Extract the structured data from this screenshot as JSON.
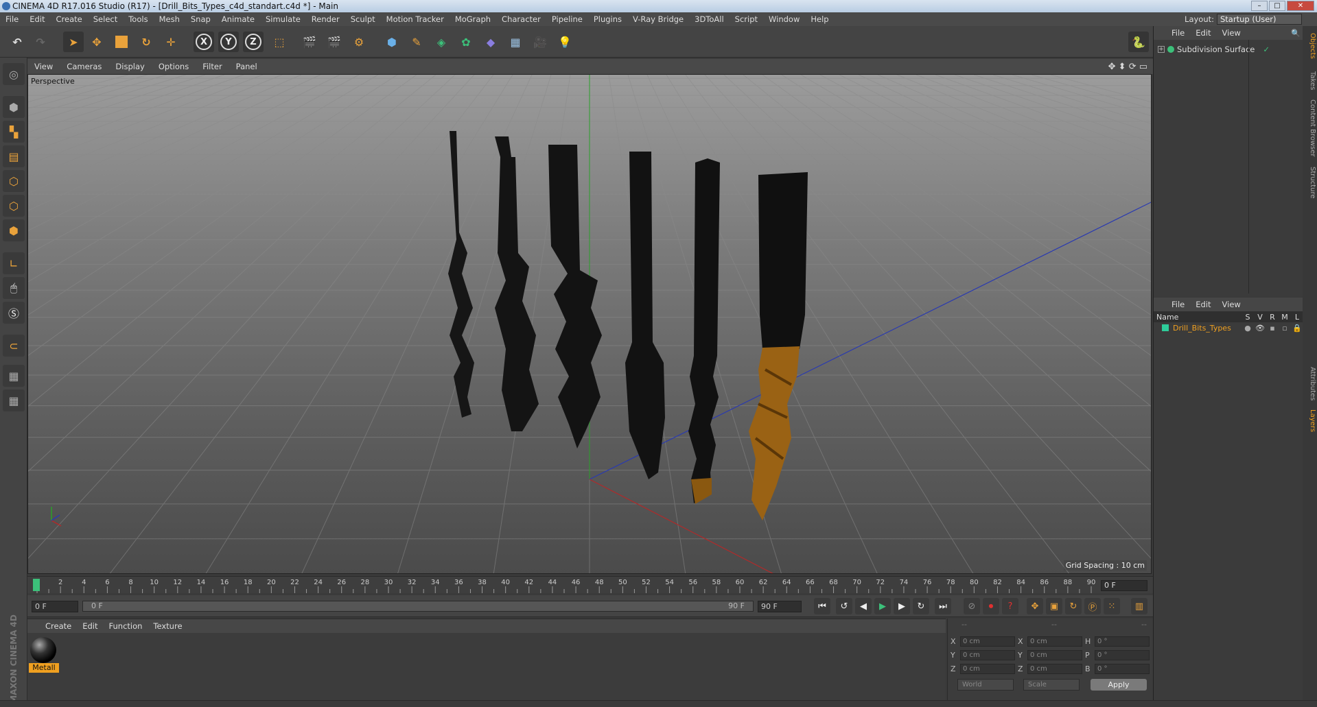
{
  "window": {
    "title": "CINEMA 4D R17.016 Studio (R17) - [Drill_Bits_Types_c4d_standart.c4d *] - Main"
  },
  "menubar": {
    "items": [
      "File",
      "Edit",
      "Create",
      "Select",
      "Tools",
      "Mesh",
      "Snap",
      "Animate",
      "Simulate",
      "Render",
      "Sculpt",
      "Motion Tracker",
      "MoGraph",
      "Character",
      "Pipeline",
      "Plugins",
      "V-Ray Bridge",
      "3DToAll",
      "Script",
      "Window",
      "Help"
    ],
    "layout_label": "Layout:",
    "layout_value": "Startup (User)"
  },
  "toolbar": {
    "axis_x": "X",
    "axis_y": "Y",
    "axis_z": "Z"
  },
  "viewport": {
    "menu": [
      "View",
      "Cameras",
      "Display",
      "Options",
      "Filter",
      "Panel"
    ],
    "label": "Perspective",
    "grid_spacing": "Grid Spacing : 10 cm"
  },
  "timeline": {
    "ticks": [
      "0",
      "2",
      "4",
      "6",
      "8",
      "10",
      "12",
      "14",
      "16",
      "18",
      "20",
      "22",
      "24",
      "26",
      "28",
      "30",
      "32",
      "34",
      "36",
      "38",
      "40",
      "42",
      "44",
      "46",
      "48",
      "50",
      "52",
      "54",
      "56",
      "58",
      "60",
      "62",
      "64",
      "66",
      "68",
      "70",
      "72",
      "74",
      "76",
      "78",
      "80",
      "82",
      "84",
      "86",
      "88",
      "90"
    ],
    "current_frame": "0 F"
  },
  "playbar": {
    "start_field": "0 F",
    "scrub_start": "0 F",
    "scrub_end": "90 F",
    "end_field": "90 F"
  },
  "material_manager": {
    "menu": [
      "Create",
      "Edit",
      "Function",
      "Texture"
    ],
    "materials": [
      {
        "name": "Metall"
      }
    ]
  },
  "brand": {
    "logo_text": "MAXON CINEMA 4D"
  },
  "coordinates": {
    "header": [
      "--",
      "--",
      "--"
    ],
    "rows": [
      {
        "a": "X",
        "av": "0 cm",
        "b": "X",
        "bv": "0 cm",
        "c": "H",
        "cv": "0 °"
      },
      {
        "a": "Y",
        "av": "0 cm",
        "b": "Y",
        "bv": "0 cm",
        "c": "P",
        "cv": "0 °"
      },
      {
        "a": "Z",
        "av": "0 cm",
        "b": "Z",
        "bv": "0 cm",
        "c": "B",
        "cv": "0 °"
      }
    ],
    "mode_world": "World",
    "mode_scale": "Scale",
    "apply": "Apply"
  },
  "object_manager": {
    "menu": [
      "File",
      "Edit",
      "View"
    ],
    "objects": [
      {
        "name": "Subdivision Surface"
      }
    ]
  },
  "layer_manager": {
    "menu": [
      "File",
      "Edit",
      "View"
    ],
    "columns": {
      "name": "Name",
      "s": "S",
      "v": "V",
      "r": "R",
      "m": "M",
      "l": "L"
    },
    "layers": [
      {
        "name": "Drill_Bits_Types",
        "color": "#2ecc9a"
      }
    ]
  },
  "side_tabs": [
    "Objects",
    "Takes",
    "Content Browser",
    "Structure",
    "Attributes",
    "Layers"
  ],
  "colors": {
    "accent": "#f0a020",
    "x_axis": "#b02a2a",
    "z_axis": "#2a3ab0",
    "y_axis": "#2aa02a"
  }
}
